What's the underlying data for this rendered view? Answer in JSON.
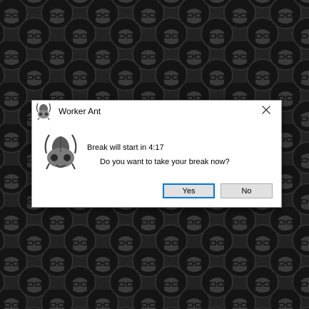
{
  "dialog": {
    "title": "Worker Ant",
    "message_line1": "Break will start in 4:17",
    "message_line2": "Do you want to take your break now?",
    "yes_label": "Yes",
    "no_label": "No",
    "app_icon": "ant-head-icon",
    "close_icon": "close-icon"
  },
  "colors": {
    "desktop_background": "#1e1e1e",
    "wallpaper_pattern": "#2b2b2b",
    "dialog_background": "#ffffff",
    "default_button_border": "#0078d7",
    "button_face": "#e1e1e1"
  }
}
